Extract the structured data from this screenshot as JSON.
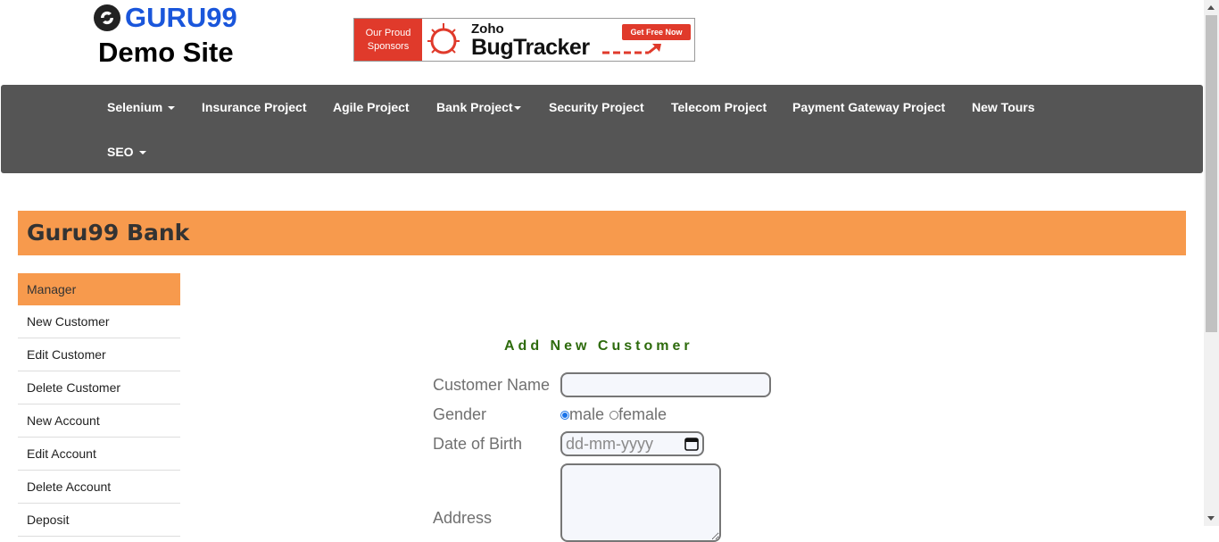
{
  "header": {
    "logo_text": "GURU99",
    "subtitle": "Demo Site"
  },
  "sponsor": {
    "left_line1": "Our Proud",
    "left_line2": "Sponsors",
    "brand_small": "Zoho",
    "brand_big": "BugTracker",
    "cta": "Get Free Now"
  },
  "navbar": {
    "items": [
      {
        "label": "Selenium",
        "dropdown": true
      },
      {
        "label": "Insurance Project",
        "dropdown": false
      },
      {
        "label": "Agile Project",
        "dropdown": false
      },
      {
        "label": "Bank Project",
        "dropdown": true
      },
      {
        "label": "Security Project",
        "dropdown": false
      },
      {
        "label": "Telecom Project",
        "dropdown": false
      },
      {
        "label": "Payment Gateway Project",
        "dropdown": false
      },
      {
        "label": "New Tours",
        "dropdown": false
      },
      {
        "label": "SEO",
        "dropdown": true
      }
    ]
  },
  "banner": {
    "title": "Guru99 Bank"
  },
  "sidebar": {
    "items": [
      {
        "label": "Manager",
        "active": true
      },
      {
        "label": "New Customer"
      },
      {
        "label": "Edit Customer"
      },
      {
        "label": "Delete Customer"
      },
      {
        "label": "New Account"
      },
      {
        "label": "Edit Account"
      },
      {
        "label": "Delete Account"
      },
      {
        "label": "Deposit"
      }
    ]
  },
  "form": {
    "title": "Add New Customer",
    "customer_name_label": "Customer Name",
    "customer_name_value": "",
    "gender_label": "Gender",
    "gender_options": [
      "male",
      "female"
    ],
    "gender_selected": "male",
    "dob_label": "Date of Birth",
    "dob_placeholder": "dd-mm-yyyy",
    "address_label": "Address",
    "address_value": ""
  },
  "colors": {
    "navbar_bg": "#555555",
    "accent_orange": "#f79a4d",
    "form_title_green": "#2e6b0d",
    "logo_blue": "#1a56db"
  }
}
